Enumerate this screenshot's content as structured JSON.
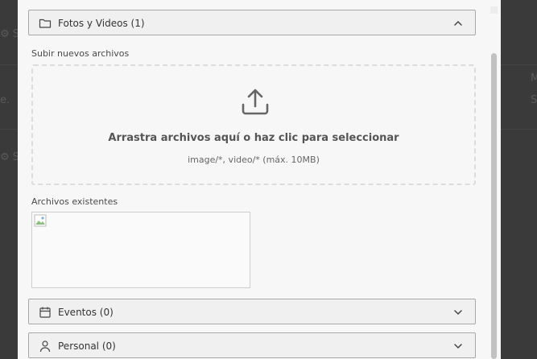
{
  "sections": {
    "photos": {
      "label": "Fotos y Videos (1)",
      "expanded": true,
      "icon": "folder-icon"
    },
    "events": {
      "label": "Eventos (0)",
      "expanded": false,
      "icon": "calendar-icon"
    },
    "personal": {
      "label": "Personal (0)",
      "expanded": false,
      "icon": "user-icon"
    }
  },
  "upload": {
    "heading": "Subir nuevos archivos",
    "dropzone_text": "Arrastra archivos aquí o haz clic para seleccionar",
    "accepted_types": "image/*, video/* (máx. 10MB)",
    "icon": "upload-icon"
  },
  "existing": {
    "heading": "Archivos existentes"
  },
  "background_fragments": {
    "frag1": "S",
    "frag2": "e.",
    "frag3": "S",
    "frag4": "M",
    "frag5": "S"
  }
}
